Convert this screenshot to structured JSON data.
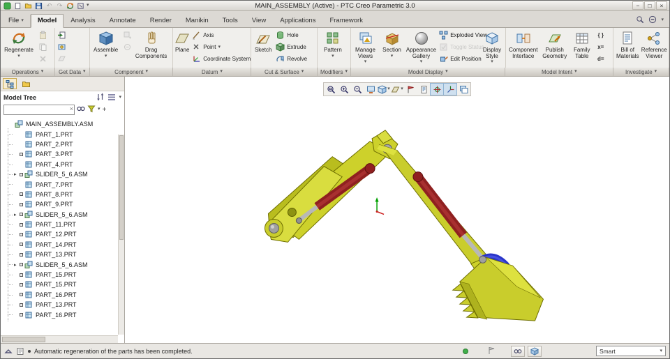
{
  "window": {
    "title": "MAIN_ASSEMBLY (Active) - PTC Creo Parametric 3.0"
  },
  "glyphs": {
    "caret": "▾",
    "expand_arrow": "▸",
    "clear": "×",
    "minimize": "−",
    "maximize": "□",
    "close": "×",
    "undo": "↶",
    "redo": "↷",
    "plus": "+"
  },
  "tabs": {
    "file": "File",
    "items": [
      "Model",
      "Analysis",
      "Annotate",
      "Render",
      "Manikin",
      "Tools",
      "View",
      "Applications",
      "Framework"
    ],
    "active_tab": "Model"
  },
  "ribbon": {
    "regenerate": "Regenerate",
    "assemble": "Assemble",
    "drag_components": "Drag Components",
    "plane": "Plane",
    "axis": "Axis",
    "point": "Point",
    "coordinate_system": "Coordinate System",
    "sketch": "Sketch",
    "hole": "Hole",
    "extrude": "Extrude",
    "revolve": "Revolve",
    "pattern": "Pattern",
    "manage_views": "Manage Views",
    "section": "Section",
    "appearance_gallery": "Appearance Gallery",
    "exploded_view": "Exploded View",
    "toggle_status": "Toggle Status",
    "edit_position": "Edit Position",
    "display_style": "Display Style",
    "component_interface": "Component Interface",
    "publish_geometry": "Publish Geometry",
    "family_table": "Family Table",
    "parameters": "{ }",
    "switch_symbols": "x=",
    "relations": "d=",
    "bill_of_materials": "Bill of Materials",
    "reference_viewer": "Reference Viewer"
  },
  "group_labels": [
    "Operations",
    "Get Data",
    "Component",
    "Datum",
    "Cut & Surface",
    "Modifiers",
    "Model Display",
    "Model Intent",
    "Investigate"
  ],
  "model_tree": {
    "title": "Model Tree",
    "search_value": "",
    "items": [
      {
        "label": "MAIN_ASSEMBLY.ASM",
        "asm": true,
        "root": true
      },
      {
        "label": "PART_1.PRT"
      },
      {
        "label": "PART_2.PRT"
      },
      {
        "label": "PART_3.PRT",
        "marker": true
      },
      {
        "label": "PART_4.PRT"
      },
      {
        "label": "SLIDER_5_6.ASM",
        "asm": true,
        "expand": true,
        "marker": true
      },
      {
        "label": "PART_7.PRT"
      },
      {
        "label": "PART_8.PRT",
        "marker": true
      },
      {
        "label": "PART_9.PRT",
        "marker": true
      },
      {
        "label": "SLIDER_5_6.ASM",
        "asm": true,
        "expand": true,
        "marker": true
      },
      {
        "label": "PART_11.PRT",
        "marker": true
      },
      {
        "label": "PART_12.PRT",
        "marker": true
      },
      {
        "label": "PART_14.PRT",
        "marker": true
      },
      {
        "label": "PART_13.PRT",
        "marker": true
      },
      {
        "label": "SLIDER_5_6.ASM",
        "asm": true,
        "expand": true,
        "marker": true
      },
      {
        "label": "PART_15.PRT",
        "marker": true
      },
      {
        "label": "PART_15.PRT",
        "marker": true
      },
      {
        "label": "PART_16.PRT",
        "marker": true
      },
      {
        "label": "PART_13.PRT",
        "marker": true
      },
      {
        "label": "PART_16.PRT",
        "marker": true
      }
    ]
  },
  "graphics": {
    "toolbar_icons": [
      "refit",
      "zoom-in",
      "zoom-out",
      "repaint",
      "display-style",
      "datum-display",
      "annotation-display",
      "show-notes",
      "spin-center",
      "3d-dragger",
      "view-manager"
    ],
    "pressed_icons": [
      "spin-center",
      "3d-dragger"
    ]
  },
  "colors": {
    "part_yellow": "#c9cd2c",
    "cylinder_red": "#8f2020",
    "link_blue": "#2a35c8",
    "pin_gray": "#9a9a9a",
    "status_green": "#3fae49"
  },
  "status_bar": {
    "message": "Automatic regeneration of the parts has been completed.",
    "filter_selector": "Smart"
  }
}
